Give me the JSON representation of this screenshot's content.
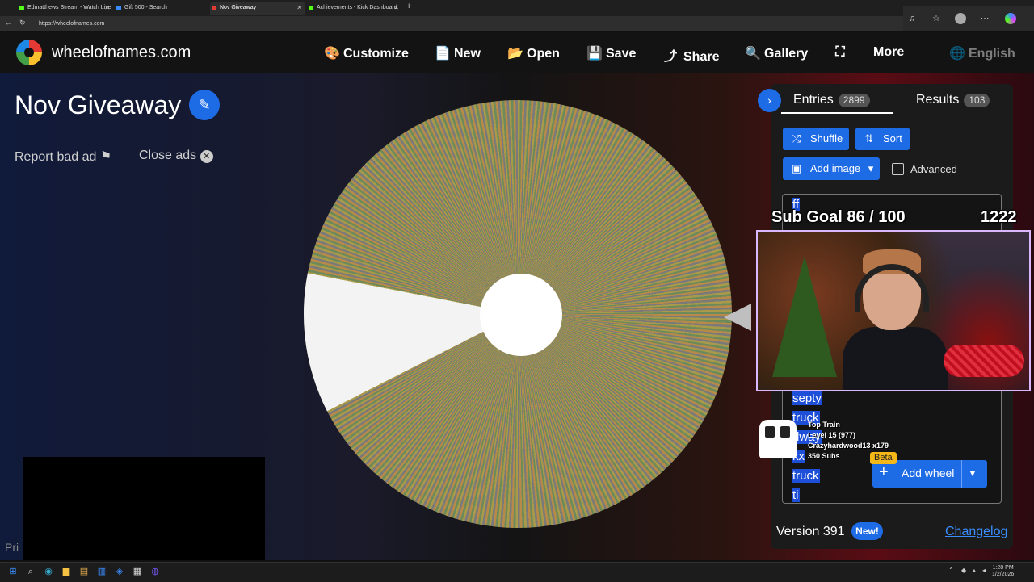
{
  "browser": {
    "tabs": [
      {
        "label": "Edmatthews Stream - Watch Live",
        "icon": "kick-icon",
        "color": "#53fc18"
      },
      {
        "label": "Gift 500 - Search",
        "icon": "search-icon",
        "color": "#3a8dff"
      },
      {
        "label": "Nov Giveaway",
        "icon": "wheel-icon",
        "color": "#e53935"
      },
      {
        "label": "Achievements - Kick Dashboard",
        "icon": "kick-icon",
        "color": "#53fc18"
      }
    ],
    "url": "https://wheelofnames.com"
  },
  "site": {
    "name": "wheelofnames.com",
    "menu": [
      {
        "label": "Customize",
        "icon": "palette-icon",
        "glyph": "🎨"
      },
      {
        "label": "New",
        "icon": "file-icon",
        "glyph": "📄"
      },
      {
        "label": "Open",
        "icon": "folder-icon",
        "glyph": "📂"
      },
      {
        "label": "Save",
        "icon": "save-icon",
        "glyph": "💾"
      },
      {
        "label": "Share",
        "icon": "share-icon",
        "glyph": "⤴"
      },
      {
        "label": "Gallery",
        "icon": "search-icon",
        "glyph": "🔍"
      },
      {
        "label": "",
        "icon": "fullscreen-icon",
        "glyph": "⛶"
      },
      {
        "label": "More",
        "icon": "",
        "glyph": ""
      },
      {
        "label": "English",
        "icon": "globe-icon",
        "glyph": "🌐"
      }
    ]
  },
  "main": {
    "title": "Nov Giveaway",
    "report_ad": "Report bad ad",
    "close_ads": "Close ads",
    "privacy_partial": "Pri"
  },
  "panel": {
    "tabs": [
      {
        "label": "Entries",
        "count": "2899"
      },
      {
        "label": "Results",
        "count": "103"
      }
    ],
    "buttons": {
      "shuffle": "Shuffle",
      "sort": "Sort",
      "add_image": "Add image",
      "advanced": "Advanced",
      "add_wheel": "Add wheel",
      "beta": "Beta"
    },
    "entries": [
      "ff",
      "septy",
      "truck",
      "dway",
      "kx",
      "truck",
      "ti"
    ],
    "version": "Version 391",
    "new_badge": "New!",
    "changelog": "Changelog"
  },
  "overlay": {
    "sub_goal": "Sub Goal 86 / 100",
    "sub_count": "1222",
    "train": [
      "Top Train",
      "Level 15 (977)",
      "Crazyhardwood13 x179",
      "350 Subs"
    ]
  },
  "taskbar": {
    "time": "1:28 PM",
    "date": "1/2/2026"
  }
}
